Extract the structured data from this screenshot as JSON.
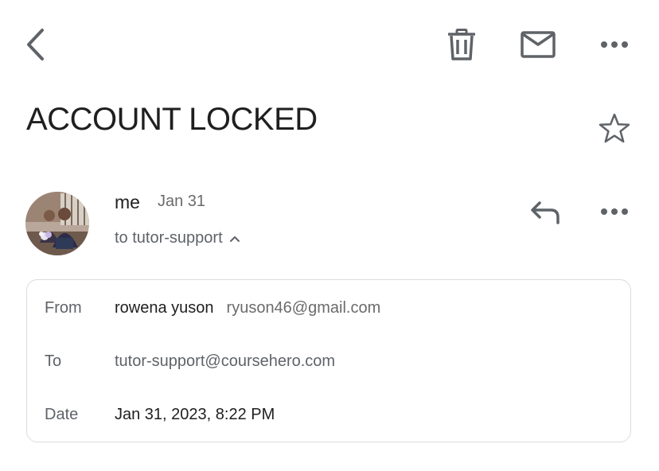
{
  "toolbar": {
    "back_icon": "chevron-left-icon",
    "delete_icon": "trash-icon",
    "mark_unread_icon": "mail-icon",
    "more_icon": "more-horizontal-icon"
  },
  "email": {
    "subject": "ACCOUNT LOCKED",
    "starred": false,
    "header": {
      "sender": "me",
      "date": "Jan 31",
      "to_summary": "to tutor-support",
      "expand_icon": "chevron-up-icon"
    },
    "details": {
      "from_label": "From",
      "from_name": "rowena yuson",
      "from_email": "ryuson46@gmail.com",
      "to_label": "To",
      "to_value": "tutor-support@coursehero.com",
      "date_label": "Date",
      "date_value": "Jan 31, 2023, 8:22 PM"
    }
  },
  "colors": {
    "icon": "#5f6368",
    "text_primary": "#1f1f1f",
    "text_secondary": "#5f6368",
    "border": "#dadce0"
  }
}
